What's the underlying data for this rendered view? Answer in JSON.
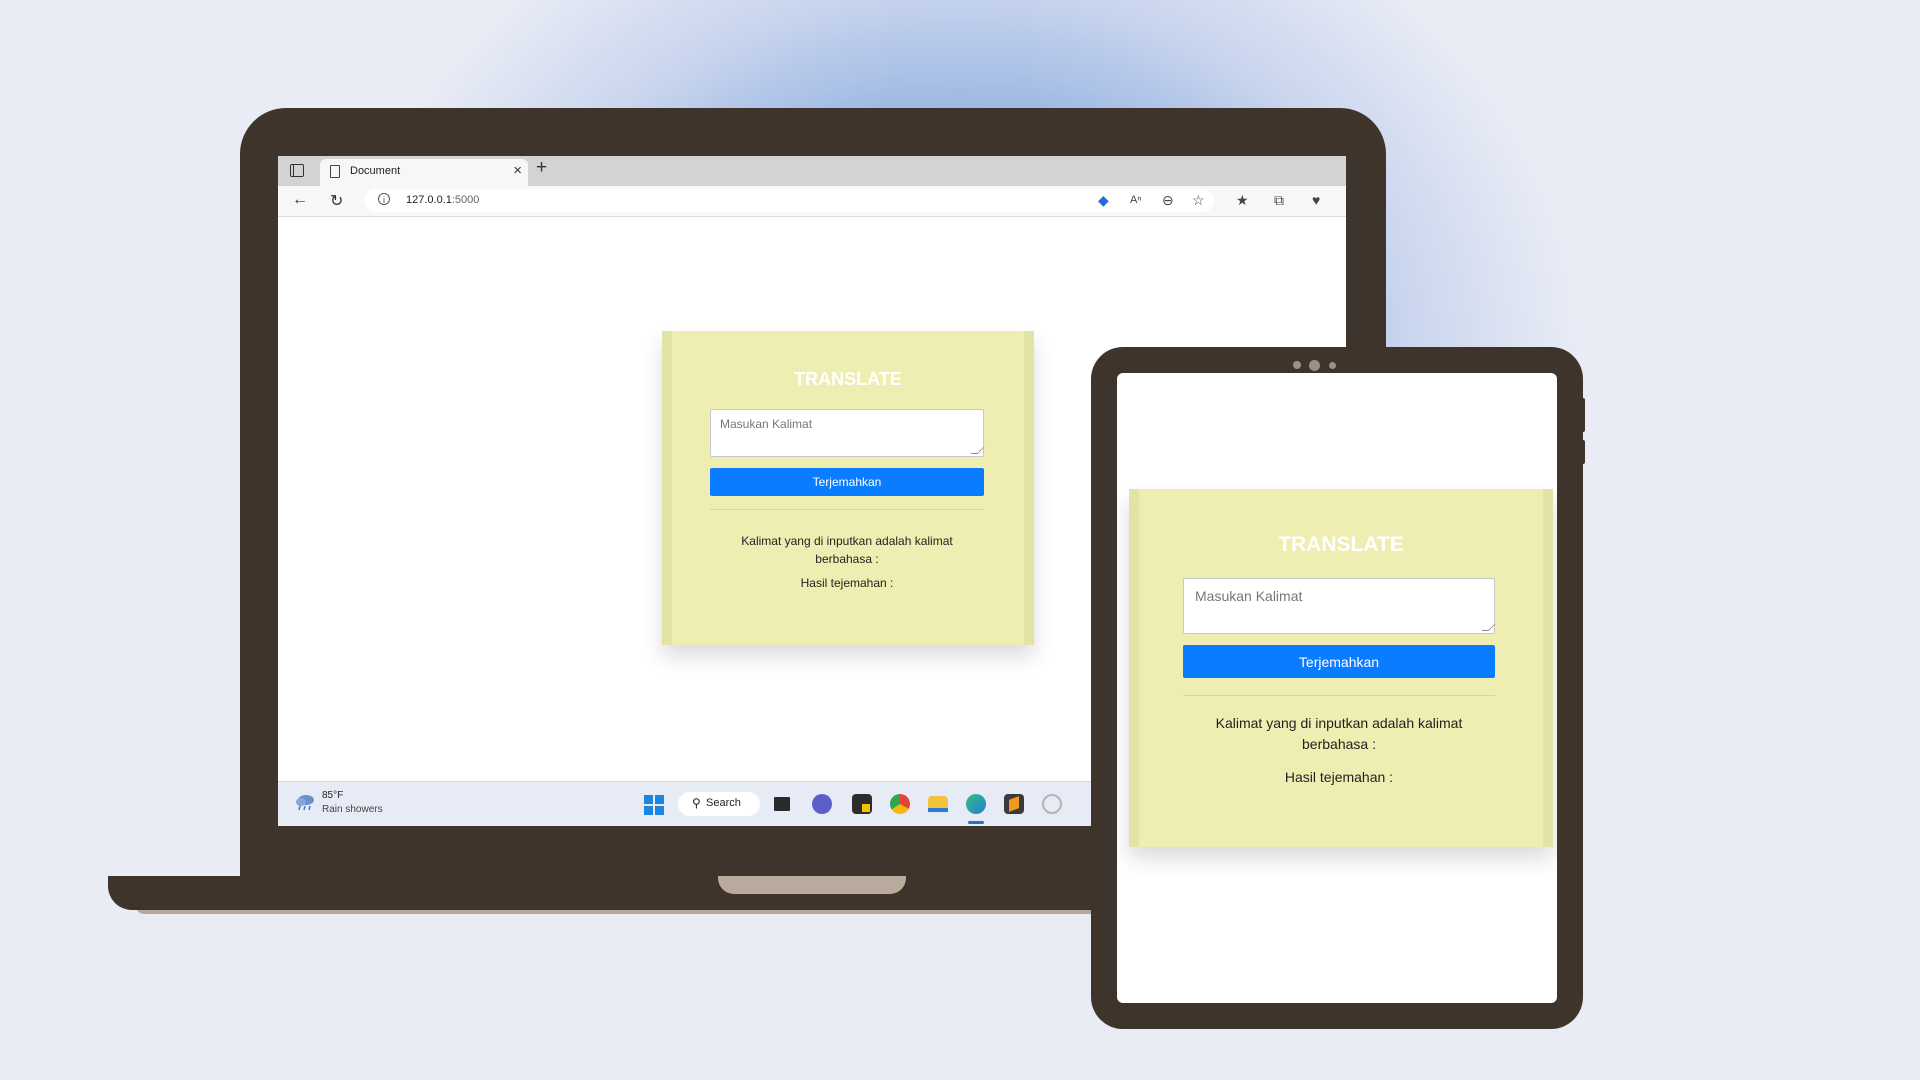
{
  "browser": {
    "tab_title": "Document",
    "url_host": "127.0.0.1",
    "url_port": ":5000",
    "new_tab_symbol": "+",
    "close_symbol": "×"
  },
  "app": {
    "title": "TRANSLATE",
    "input_placeholder": "Masukan Kalimat",
    "button_label": "Terjemahkan",
    "detect_text": "Kalimat yang di inputkan adalah kalimat berbahasa :",
    "result_label": "Hasil tejemahan :"
  },
  "taskbar": {
    "weather_temp": "85°F",
    "weather_desc": "Rain showers",
    "search_label": "Search",
    "apps": [
      "task-view-icon",
      "teams-chat-icon",
      "sticky-notes-icon",
      "chrome-icon",
      "file-explorer-icon",
      "edge-icon",
      "sublime-text-icon",
      "fingerprint-icon"
    ]
  },
  "colors": {
    "card_bg": "#eeeeb2",
    "button_bg": "#0a7cff",
    "device_frame": "#3e342c"
  }
}
